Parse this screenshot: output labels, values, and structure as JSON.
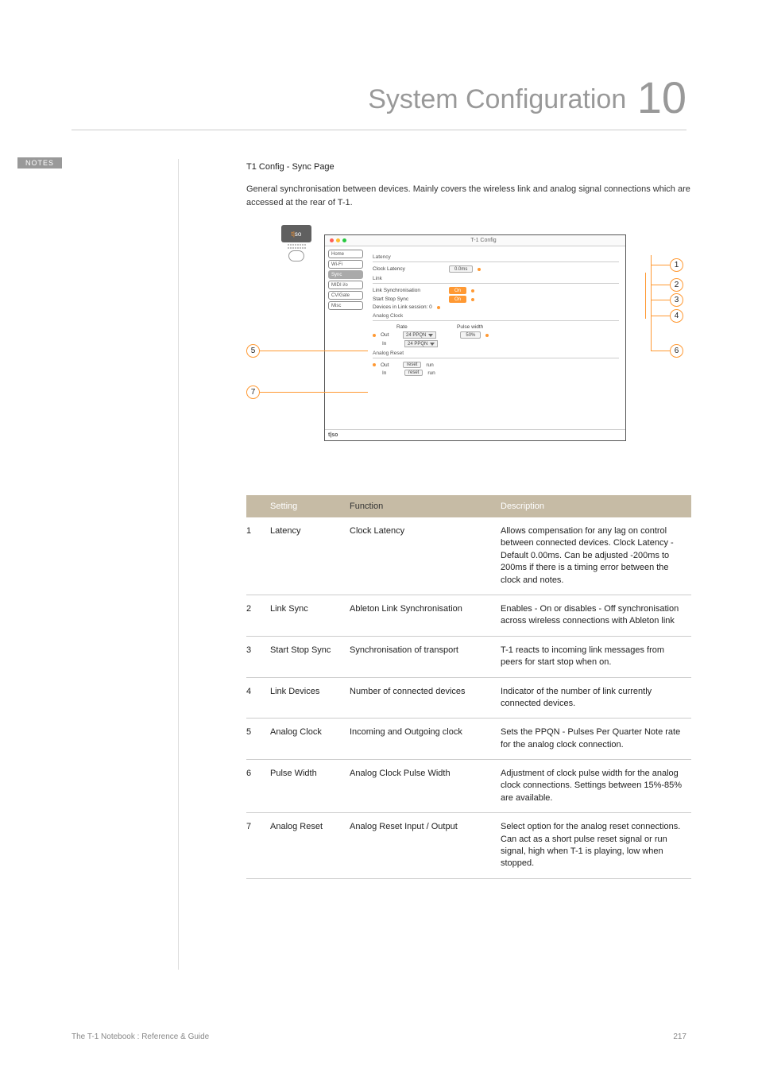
{
  "chapter": {
    "title": "System Configuration",
    "number": "10"
  },
  "notes_label": "NOTES",
  "content": {
    "heading": "T1 Config - Sync Page",
    "description": "General synchronisation between devices. Mainly covers the wireless link and analog signal connections which are accessed at the rear of T-1."
  },
  "device": {
    "brand1": "t|",
    "brand2": "so"
  },
  "window": {
    "title": "T-1 Config",
    "footer_brand": "t|so",
    "sidebar": [
      "Home",
      "Wi-Fi",
      "Sync",
      "MIDI i/o",
      "CV/Gate",
      "Misc"
    ],
    "sections": {
      "latency": {
        "label": "Latency",
        "row_label": "Clock Latency",
        "value": "0.0ms"
      },
      "link": {
        "label": "Link",
        "sync_label": "Link Synchronisation",
        "sync_value": "On",
        "startstop_label": "Start Stop Sync",
        "startstop_value": "On",
        "devices_label": "Devices in Link session: 0"
      },
      "analog_clock": {
        "label": "Analog Clock",
        "col1": "Rate",
        "col2": "Pulse width",
        "out_label": "Out",
        "in_label": "In",
        "rate_value": "24 PPQN",
        "pulse_value": "50%"
      },
      "analog_reset": {
        "label": "Analog Reset",
        "out_label": "Out",
        "in_label": "In",
        "reset_pill": "reset",
        "run_pill": "run"
      }
    }
  },
  "callouts": {
    "c1": "1",
    "c2": "2",
    "c3": "3",
    "c4": "4",
    "c5": "5",
    "c6": "6",
    "c7": "7"
  },
  "table": {
    "headers": {
      "setting": "Setting",
      "function": "Function",
      "description": "Description"
    },
    "rows": [
      {
        "n": "1",
        "setting": "Latency",
        "function": "Clock Latency",
        "desc": "Allows compensation for any lag on control between connected devices. Clock Latency - Default 0.00ms. Can be adjusted -200ms to 200ms if there is a timing error between the clock and notes."
      },
      {
        "n": "2",
        "setting": "Link Sync",
        "function": "Ableton Link Synchronisation",
        "desc": "Enables - On or disables - Off synchronisation across wireless connections with Ableton link"
      },
      {
        "n": "3",
        "setting": "Start Stop Sync",
        "function": "Synchronisation of transport",
        "desc": "T-1 reacts to incoming link messages from peers for start stop when on."
      },
      {
        "n": "4",
        "setting": "Link Devices",
        "function": "Number of connected devices",
        "desc": "Indicator of the number of link currently connected devices."
      },
      {
        "n": "5",
        "setting": "Analog Clock",
        "function": "Incoming and Outgoing clock",
        "desc": "Sets the PPQN - Pulses Per Quarter Note rate for the analog clock connection."
      },
      {
        "n": "6",
        "setting": "Pulse Width",
        "function": "Analog Clock Pulse Width",
        "desc": "Adjustment of clock pulse width for the analog clock connections. Settings between 15%-85% are available."
      },
      {
        "n": "7",
        "setting": "Analog Reset",
        "function": "Analog Reset Input / Output",
        "desc": "Select option for the analog reset connections. Can act as a short pulse reset signal or run signal, high when T-1 is playing, low when stopped."
      }
    ]
  },
  "footer": {
    "left": "The T-1 Notebook : Reference & Guide",
    "right": "217"
  }
}
